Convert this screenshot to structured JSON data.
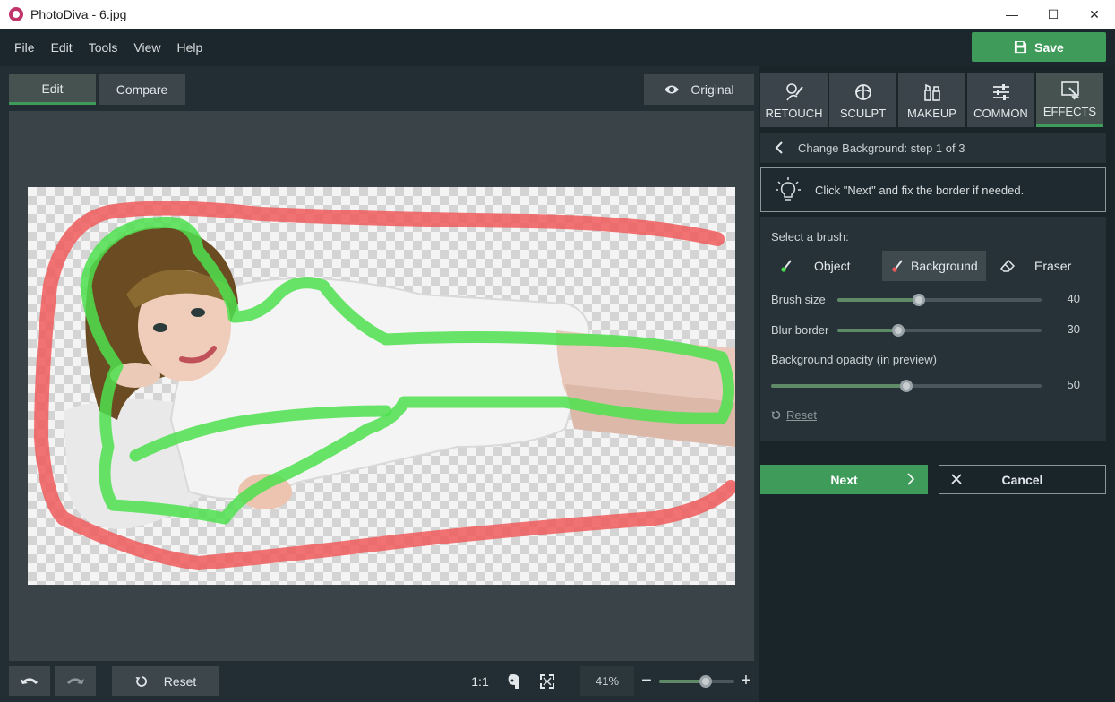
{
  "window": {
    "title": "PhotoDiva - 6.jpg",
    "controls": {
      "minimize": "—",
      "maximize": "☐",
      "close": "✕"
    }
  },
  "menu": {
    "items": [
      "File",
      "Edit",
      "Tools",
      "View",
      "Help"
    ],
    "save_label": "Save"
  },
  "workspace": {
    "tabs": [
      {
        "label": "Edit",
        "active": true
      },
      {
        "label": "Compare",
        "active": false
      }
    ],
    "original_label": "Original"
  },
  "bottom_bar": {
    "reset_label": "Reset",
    "ratio_label": "1:1",
    "zoom_value": "41%",
    "zoom_level": 0.62,
    "zoom_minus": "−",
    "zoom_plus": "+"
  },
  "tool_tabs": [
    {
      "label": "RETOUCH",
      "icon": "retouch-icon",
      "active": false
    },
    {
      "label": "SCULPT",
      "icon": "sculpt-icon",
      "active": false
    },
    {
      "label": "MAKEUP",
      "icon": "makeup-icon",
      "active": false
    },
    {
      "label": "COMMON",
      "icon": "sliders-icon",
      "active": false
    },
    {
      "label": "EFFECTS",
      "icon": "effects-icon",
      "active": true
    }
  ],
  "step": {
    "header": "Change Background: step 1 of 3",
    "hint": "Click \"Next\" and fix the border if needed."
  },
  "brush": {
    "select_label": "Select a brush:",
    "options": [
      {
        "label": "Object",
        "selected": false
      },
      {
        "label": "Background",
        "selected": true
      },
      {
        "label": "Eraser",
        "selected": false
      }
    ],
    "sliders": [
      {
        "label": "Brush size",
        "value": "40",
        "fraction": 0.4
      },
      {
        "label": "Blur border",
        "value": "30",
        "fraction": 0.3
      },
      {
        "label": "Background opacity (in preview)",
        "value": "50",
        "fraction": 0.5
      }
    ],
    "reset_label": "Reset"
  },
  "actions": {
    "next_label": "Next",
    "cancel_label": "Cancel"
  },
  "colors": {
    "accent_green": "#3f9b5a",
    "object_brush": "#4de04d",
    "background_brush": "#f05a5a"
  }
}
